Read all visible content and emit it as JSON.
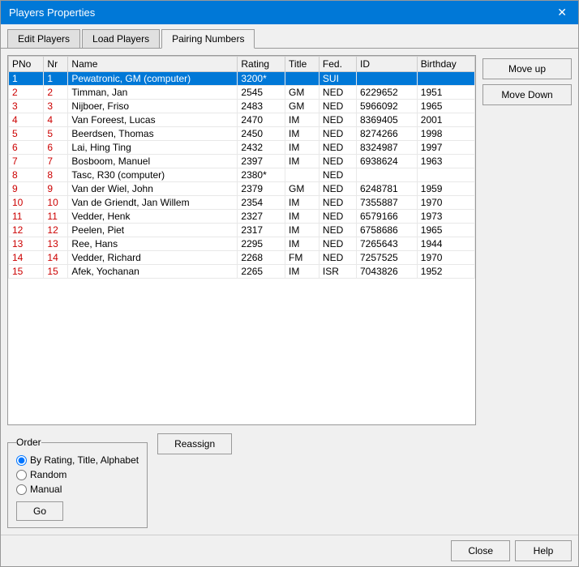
{
  "dialog": {
    "title": "Players Properties",
    "close_label": "✕"
  },
  "tabs": [
    {
      "id": "edit-players",
      "label": "Edit Players",
      "active": false
    },
    {
      "id": "load-players",
      "label": "Load Players",
      "active": false
    },
    {
      "id": "pairing-numbers",
      "label": "Pairing Numbers",
      "active": true
    }
  ],
  "table": {
    "columns": [
      "PNo",
      "Nr",
      "Name",
      "Rating",
      "Title",
      "Fed.",
      "ID",
      "Birthday"
    ],
    "rows": [
      {
        "pno": "1",
        "nr": "1",
        "name": "Pewatronic, GM (computer)",
        "rating": "3200",
        "rating_note": "*",
        "title": "",
        "fed": "SUI",
        "id": "",
        "birthday": ""
      },
      {
        "pno": "2",
        "nr": "2",
        "name": "Timman, Jan",
        "rating": "2545",
        "rating_note": "",
        "title": "GM",
        "fed": "NED",
        "id": "6229652",
        "birthday": "1951"
      },
      {
        "pno": "3",
        "nr": "3",
        "name": "Nijboer, Friso",
        "rating": "2483",
        "rating_note": "",
        "title": "GM",
        "fed": "NED",
        "id": "5966092",
        "birthday": "1965"
      },
      {
        "pno": "4",
        "nr": "4",
        "name": "Van Foreest, Lucas",
        "rating": "2470",
        "rating_note": "",
        "title": "IM",
        "fed": "NED",
        "id": "8369405",
        "birthday": "2001"
      },
      {
        "pno": "5",
        "nr": "5",
        "name": "Beerdsen, Thomas",
        "rating": "2450",
        "rating_note": "",
        "title": "IM",
        "fed": "NED",
        "id": "8274266",
        "birthday": "1998"
      },
      {
        "pno": "6",
        "nr": "6",
        "name": "Lai, Hing Ting",
        "rating": "2432",
        "rating_note": "",
        "title": "IM",
        "fed": "NED",
        "id": "8324987",
        "birthday": "1997"
      },
      {
        "pno": "7",
        "nr": "7",
        "name": "Bosboom, Manuel",
        "rating": "2397",
        "rating_note": "",
        "title": "IM",
        "fed": "NED",
        "id": "6938624",
        "birthday": "1963"
      },
      {
        "pno": "8",
        "nr": "8",
        "name": "Tasc, R30 (computer)",
        "rating": "2380",
        "rating_note": "*",
        "title": "",
        "fed": "NED",
        "id": "",
        "birthday": ""
      },
      {
        "pno": "9",
        "nr": "9",
        "name": "Van der Wiel, John",
        "rating": "2379",
        "rating_note": "",
        "title": "GM",
        "fed": "NED",
        "id": "6248781",
        "birthday": "1959"
      },
      {
        "pno": "10",
        "nr": "10",
        "name": "Van de Griendt, Jan Willem",
        "rating": "2354",
        "rating_note": "",
        "title": "IM",
        "fed": "NED",
        "id": "7355887",
        "birthday": "1970"
      },
      {
        "pno": "11",
        "nr": "11",
        "name": "Vedder, Henk",
        "rating": "2327",
        "rating_note": "",
        "title": "IM",
        "fed": "NED",
        "id": "6579166",
        "birthday": "1973"
      },
      {
        "pno": "12",
        "nr": "12",
        "name": "Peelen, Piet",
        "rating": "2317",
        "rating_note": "",
        "title": "IM",
        "fed": "NED",
        "id": "6758686",
        "birthday": "1965"
      },
      {
        "pno": "13",
        "nr": "13",
        "name": "Ree, Hans",
        "rating": "2295",
        "rating_note": "",
        "title": "IM",
        "fed": "NED",
        "id": "7265643",
        "birthday": "1944"
      },
      {
        "pno": "14",
        "nr": "14",
        "name": "Vedder, Richard",
        "rating": "2268",
        "rating_note": "",
        "title": "FM",
        "fed": "NED",
        "id": "7257525",
        "birthday": "1970"
      },
      {
        "pno": "15",
        "nr": "15",
        "name": "Afek, Yochanan",
        "rating": "2265",
        "rating_note": "",
        "title": "IM",
        "fed": "ISR",
        "id": "7043826",
        "birthday": "1952"
      }
    ]
  },
  "buttons": {
    "move_up": "Move up",
    "move_down": "Move Down",
    "reassign": "Reassign",
    "go": "Go",
    "close": "Close",
    "help": "Help"
  },
  "order": {
    "label": "Order",
    "options": [
      {
        "id": "by-rating",
        "label": "By Rating, Title, Alphabet",
        "checked": true
      },
      {
        "id": "random",
        "label": "Random",
        "checked": false
      },
      {
        "id": "manual",
        "label": "Manual",
        "checked": false
      }
    ]
  }
}
